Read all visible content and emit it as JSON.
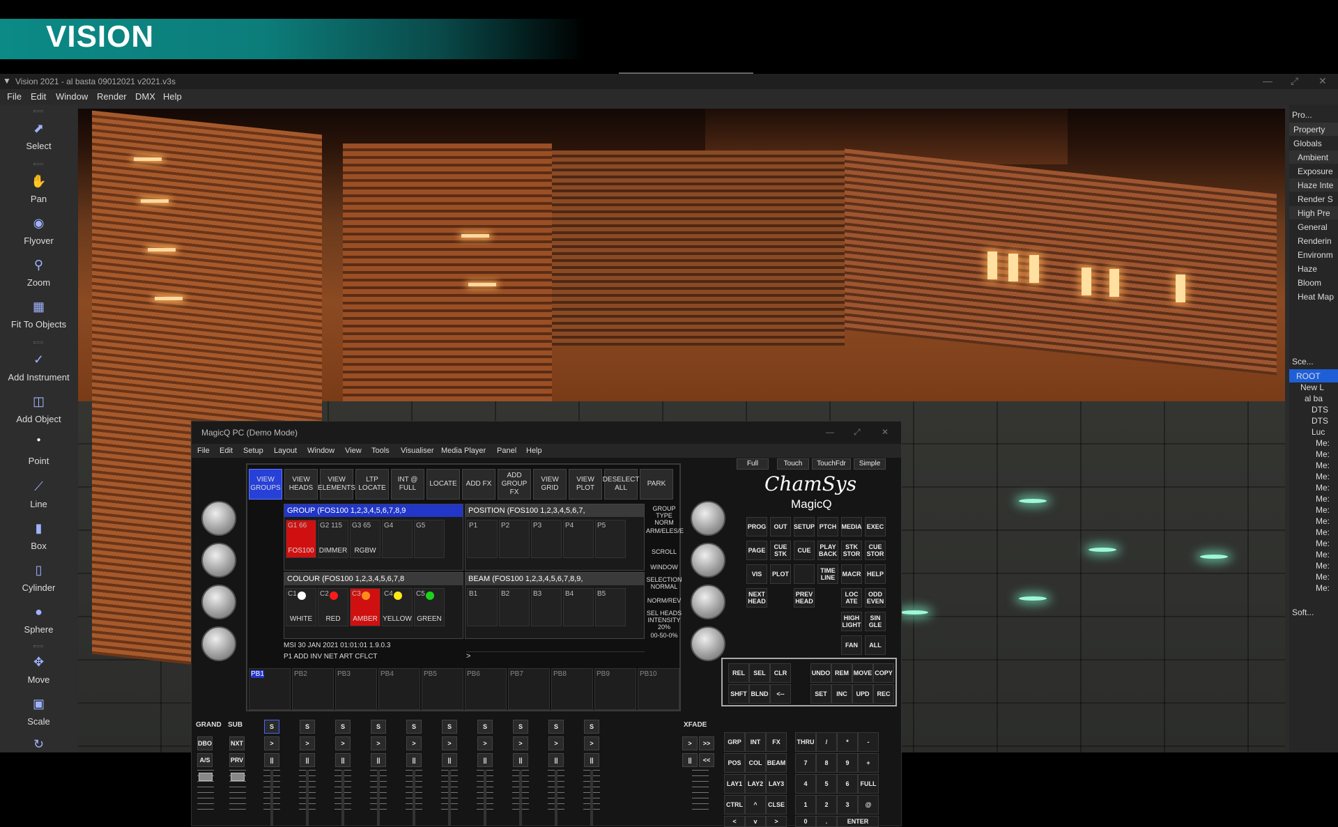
{
  "banner": {
    "title": "VISION"
  },
  "window": {
    "title": "Vision 2021 - al basta 09012021 v2021.v3s"
  },
  "menu": [
    "File",
    "Edit",
    "Window",
    "Render",
    "DMX",
    "Help"
  ],
  "tools": [
    {
      "name": "select",
      "label": "Select",
      "icon": "cursor-icon"
    },
    {
      "name": "pan",
      "label": "Pan",
      "icon": "hand-icon"
    },
    {
      "name": "flyover",
      "label": "Flyover",
      "icon": "eye-icon"
    },
    {
      "name": "zoom",
      "label": "Zoom",
      "icon": "magnifier-icon"
    },
    {
      "name": "fit",
      "label": "Fit To Objects",
      "icon": "fit-icon"
    },
    {
      "name": "add-instrument",
      "label": "Add Instrument",
      "icon": "instrument-icon"
    },
    {
      "name": "add-object",
      "label": "Add Object",
      "icon": "object-icon"
    },
    {
      "name": "point",
      "label": "Point",
      "icon": "point-icon"
    },
    {
      "name": "line",
      "label": "Line",
      "icon": "line-icon"
    },
    {
      "name": "box",
      "label": "Box",
      "icon": "box-icon"
    },
    {
      "name": "cylinder",
      "label": "Cylinder",
      "icon": "cylinder-icon"
    },
    {
      "name": "sphere",
      "label": "Sphere",
      "icon": "sphere-icon"
    },
    {
      "name": "move",
      "label": "Move",
      "icon": "move-icon"
    },
    {
      "name": "scale",
      "label": "Scale",
      "icon": "scale-icon"
    }
  ],
  "props": {
    "title": "Pro...",
    "header": "Property",
    "rows": [
      "Globals",
      "Ambient",
      "Exposure",
      "Haze Inte",
      "Render S",
      "High Pre",
      "General",
      "Renderin",
      "Environm",
      "Haze",
      "Bloom",
      "Heat Map"
    ]
  },
  "scene": {
    "title": "Sce...",
    "rows": [
      "ROOT",
      "New L",
      "al ba",
      "DTS",
      "DTS",
      "Luc",
      "Me:",
      "Me:",
      "Me:",
      "Me:",
      "Me:",
      "Me:",
      "Me:",
      "Me:",
      "Me:",
      "Me:",
      "Me:",
      "Me:",
      "Me:",
      "Me:"
    ],
    "soft": "Soft..."
  },
  "magicq": {
    "title": "MagicQ PC (Demo Mode)",
    "menu": [
      "File",
      "Edit",
      "Setup",
      "Layout",
      "Window",
      "View",
      "Tools",
      "Visualiser",
      "Media Player",
      "Panel",
      "Help"
    ],
    "top_buttons": [
      "VIEW GROUPS",
      "VIEW HEADS",
      "VIEW ELEMENTS",
      "LTP LOCATE",
      "INT @ FULL",
      "LOCATE",
      "ADD FX",
      "ADD GROUP FX",
      "VIEW GRID",
      "VIEW PLOT",
      "DESELECT ALL",
      "PARK"
    ],
    "group_title": "GROUP (FOS100 1,2,3,4,5,6,7,8,9",
    "position_title": "POSITION (FOS100 1,2,3,4,5,6,7,",
    "colour_title": "COLOUR (FOS100 1,2,3,4,5,6,7,8",
    "beam_title": "BEAM (FOS100 1,2,3,4,5,6,7,8,9,",
    "groups": [
      {
        "n": "G1 66",
        "l": "FOS100"
      },
      {
        "n": "G2 115",
        "l": "DIMMER"
      },
      {
        "n": "G3 65",
        "l": "RGBW"
      },
      {
        "n": "G4",
        "l": ""
      },
      {
        "n": "G5",
        "l": ""
      }
    ],
    "positions": [
      "P1",
      "P2",
      "P3",
      "P4",
      "P5"
    ],
    "colours": [
      {
        "n": "C1",
        "l": "WHITE",
        "c": "#ffffff"
      },
      {
        "n": "C2",
        "l": "RED",
        "c": "#ff1a1a"
      },
      {
        "n": "C3",
        "l": "AMBER",
        "c": "#ff8c1a"
      },
      {
        "n": "C4",
        "l": "YELLOW",
        "c": "#ffe81a"
      },
      {
        "n": "C5",
        "l": "GREEN",
        "c": "#1ad41a"
      }
    ],
    "beams": [
      "B1",
      "B2",
      "B3",
      "B4",
      "B5"
    ],
    "side_labels": [
      "GROUP TYPE NORM",
      "ARM/ELES/E",
      "SCROLL",
      "WINDOW",
      "SELECTION NORMAL",
      "NORM/REV",
      "SEL HEADS INTENSITY 20%",
      "00-50-0%"
    ],
    "status": "MSI 30 JAN 2021 01:01:01 1.9.0.3",
    "status2": "P1  ADD INV NET ART CFLCT",
    "cmdline": ">",
    "playbacks": [
      "PB1",
      "PB2",
      "PB3",
      "PB4",
      "PB5",
      "PB6",
      "PB7",
      "PB8",
      "PB9",
      "PB10"
    ],
    "mode_buttons": [
      "Full",
      "Touch",
      "TouchFdr",
      "Simple"
    ],
    "brand": "ChamSys",
    "product": "MagicQ",
    "keys1": [
      "PROG",
      "OUT",
      "SETUP",
      "PTCH",
      "MEDIA",
      "EXEC"
    ],
    "keys2": [
      "PAGE",
      "CUE STK",
      "CUE",
      "PLAY BACK",
      "STK STOR",
      "CUE STOR"
    ],
    "keys3": [
      "VIS",
      "PLOT",
      "",
      "TIME LINE",
      "MACR",
      "HELP"
    ],
    "keys4": [
      "NEXT HEAD",
      "PREV HEAD",
      "LOC ATE",
      "ODD EVEN"
    ],
    "keys5": [
      "HIGH LIGHT",
      "SIN GLE"
    ],
    "keys6": [
      "FAN",
      "ALL"
    ],
    "prog_keys1": [
      "REL",
      "SEL",
      "CLR",
      "UNDO",
      "REM",
      "MOVE",
      "COPY"
    ],
    "prog_keys2": [
      "SHFT",
      "BLND",
      "<--",
      "SET",
      "INC",
      "UPD",
      "REC"
    ],
    "fader_labels": {
      "grand": "GRAND",
      "sub": "SUB",
      "xfade": "XFADE",
      "dbo": "DBO",
      "nxt": "NXT",
      "as": "A/S",
      "prv": "PRV",
      "s": "S"
    },
    "pad_rows": [
      [
        "GRP",
        "INT",
        "FX",
        "THRU",
        "/",
        "*",
        "-"
      ],
      [
        "POS",
        "COL",
        "BEAM",
        "7",
        "8",
        "9",
        "+"
      ],
      [
        "LAY1",
        "LAY2",
        "LAY3",
        "4",
        "5",
        "6",
        "FULL"
      ],
      [
        "CTRL",
        "^",
        "CLSE",
        "1",
        "2",
        "3",
        "@"
      ],
      [
        "<",
        "v",
        ">",
        "0",
        ".",
        "ENTER",
        ""
      ]
    ]
  }
}
